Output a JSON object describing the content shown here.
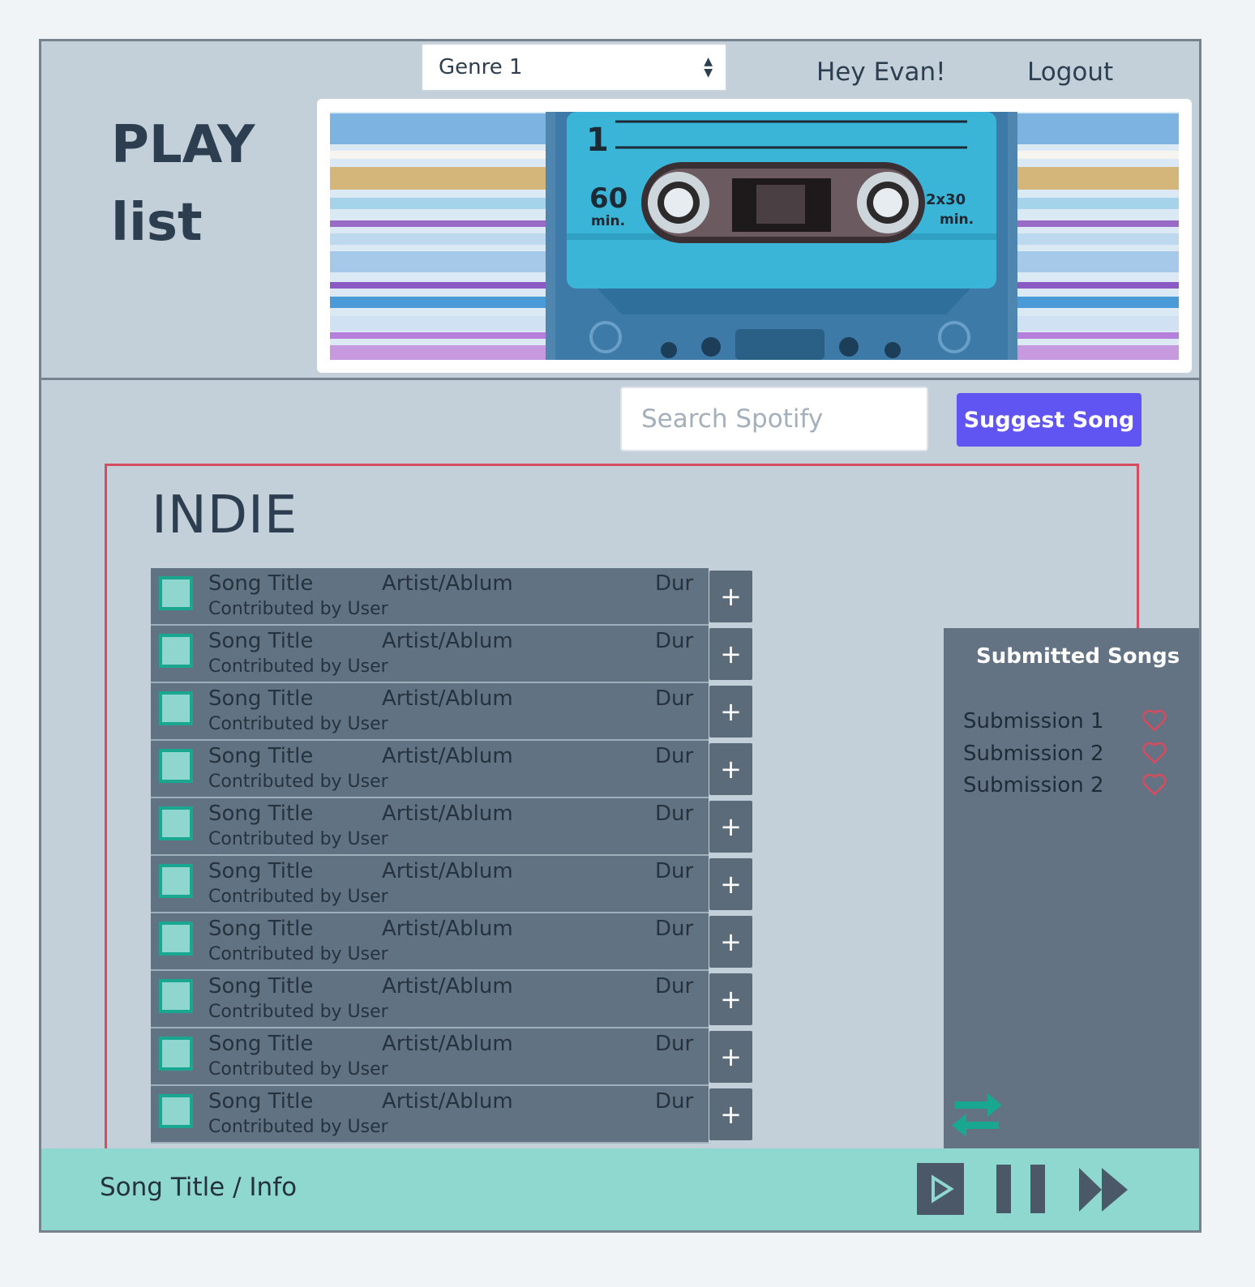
{
  "header": {
    "genre_select": {
      "value": "Genre 1"
    },
    "greeting": "Hey Evan!",
    "logout_label": "Logout",
    "brand": {
      "line1": "PLAY",
      "line2": "list"
    }
  },
  "hero_image": {
    "cassette_side": "1",
    "cassette_left_label": "60",
    "cassette_left_unit": "min.",
    "cassette_right_label": "2x30",
    "cassette_right_unit": "min."
  },
  "search": {
    "placeholder": "Search Spotify"
  },
  "suggest_button": "Suggest Song",
  "playlist": {
    "genre": "INDIE",
    "songs": [
      {
        "title": "Song Title",
        "artist": "Artist/Ablum",
        "duration": "Dur",
        "contributor": "Contributed by User"
      },
      {
        "title": "Song Title",
        "artist": "Artist/Ablum",
        "duration": "Dur",
        "contributor": "Contributed by User"
      },
      {
        "title": "Song Title",
        "artist": "Artist/Ablum",
        "duration": "Dur",
        "contributor": "Contributed by User"
      },
      {
        "title": "Song Title",
        "artist": "Artist/Ablum",
        "duration": "Dur",
        "contributor": "Contributed by User"
      },
      {
        "title": "Song Title",
        "artist": "Artist/Ablum",
        "duration": "Dur",
        "contributor": "Contributed by User"
      },
      {
        "title": "Song Title",
        "artist": "Artist/Ablum",
        "duration": "Dur",
        "contributor": "Contributed by User"
      },
      {
        "title": "Song Title",
        "artist": "Artist/Ablum",
        "duration": "Dur",
        "contributor": "Contributed by User"
      },
      {
        "title": "Song Title",
        "artist": "Artist/Ablum",
        "duration": "Dur",
        "contributor": "Contributed by User"
      },
      {
        "title": "Song Title",
        "artist": "Artist/Ablum",
        "duration": "Dur",
        "contributor": "Contributed by User"
      },
      {
        "title": "Song Title",
        "artist": "Artist/Ablum",
        "duration": "Dur",
        "contributor": "Contributed by User"
      }
    ],
    "add_label": "+"
  },
  "submitted": {
    "title": "Submitted Songs",
    "items": [
      "Submission 1",
      "Submission 2",
      "Submission 2"
    ]
  },
  "player": {
    "now_playing": "Song Title / Info"
  },
  "colors": {
    "accent_purple": "#6055f2",
    "teal": "#8fd8cf",
    "heart_red": "#d64b5e",
    "panel_slate": "#617282"
  },
  "icons": [
    "chevron-updown-icon",
    "plus-icon",
    "heart-icon",
    "swap-icon",
    "play-icon",
    "pause-icon",
    "fast-forward-icon"
  ]
}
